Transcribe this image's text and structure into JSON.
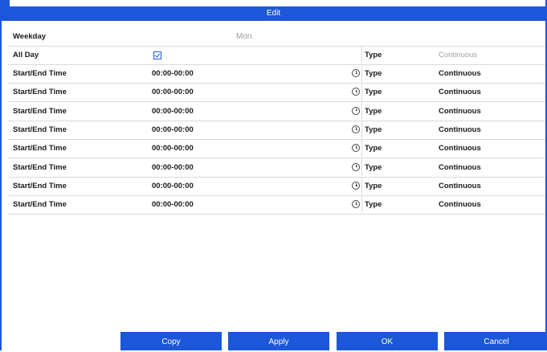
{
  "window": {
    "title": "Edit"
  },
  "weekday": {
    "label": "Weekday",
    "value": "Mon"
  },
  "all_day": {
    "label": "All Day",
    "checked": true,
    "type_label": "Type",
    "type_value": "Continuous"
  },
  "periods": [
    {
      "label": "Start/End Time",
      "time": "00:00-00:00",
      "type_label": "Type",
      "type_value": "Continuous"
    },
    {
      "label": "Start/End Time",
      "time": "00:00-00:00",
      "type_label": "Type",
      "type_value": "Continuous"
    },
    {
      "label": "Start/End Time",
      "time": "00:00-00:00",
      "type_label": "Type",
      "type_value": "Continuous"
    },
    {
      "label": "Start/End Time",
      "time": "00:00-00:00",
      "type_label": "Type",
      "type_value": "Continuous"
    },
    {
      "label": "Start/End Time",
      "time": "00:00-00:00",
      "type_label": "Type",
      "type_value": "Continuous"
    },
    {
      "label": "Start/End Time",
      "time": "00:00-00:00",
      "type_label": "Type",
      "type_value": "Continuous"
    },
    {
      "label": "Start/End Time",
      "time": "00:00-00:00",
      "type_label": "Type",
      "type_value": "Continuous"
    },
    {
      "label": "Start/End Time",
      "time": "00:00-00:00",
      "type_label": "Type",
      "type_value": "Continuous"
    }
  ],
  "buttons": {
    "copy": "Copy",
    "apply": "Apply",
    "ok": "OK",
    "cancel": "Cancel"
  },
  "colors": {
    "accent": "#1c57d9",
    "divider": "#d9d9d9",
    "muted_text": "#a0a0a0"
  },
  "icons": {
    "period_time": "clock-icon",
    "all_day": "checkbox-checked-icon"
  }
}
